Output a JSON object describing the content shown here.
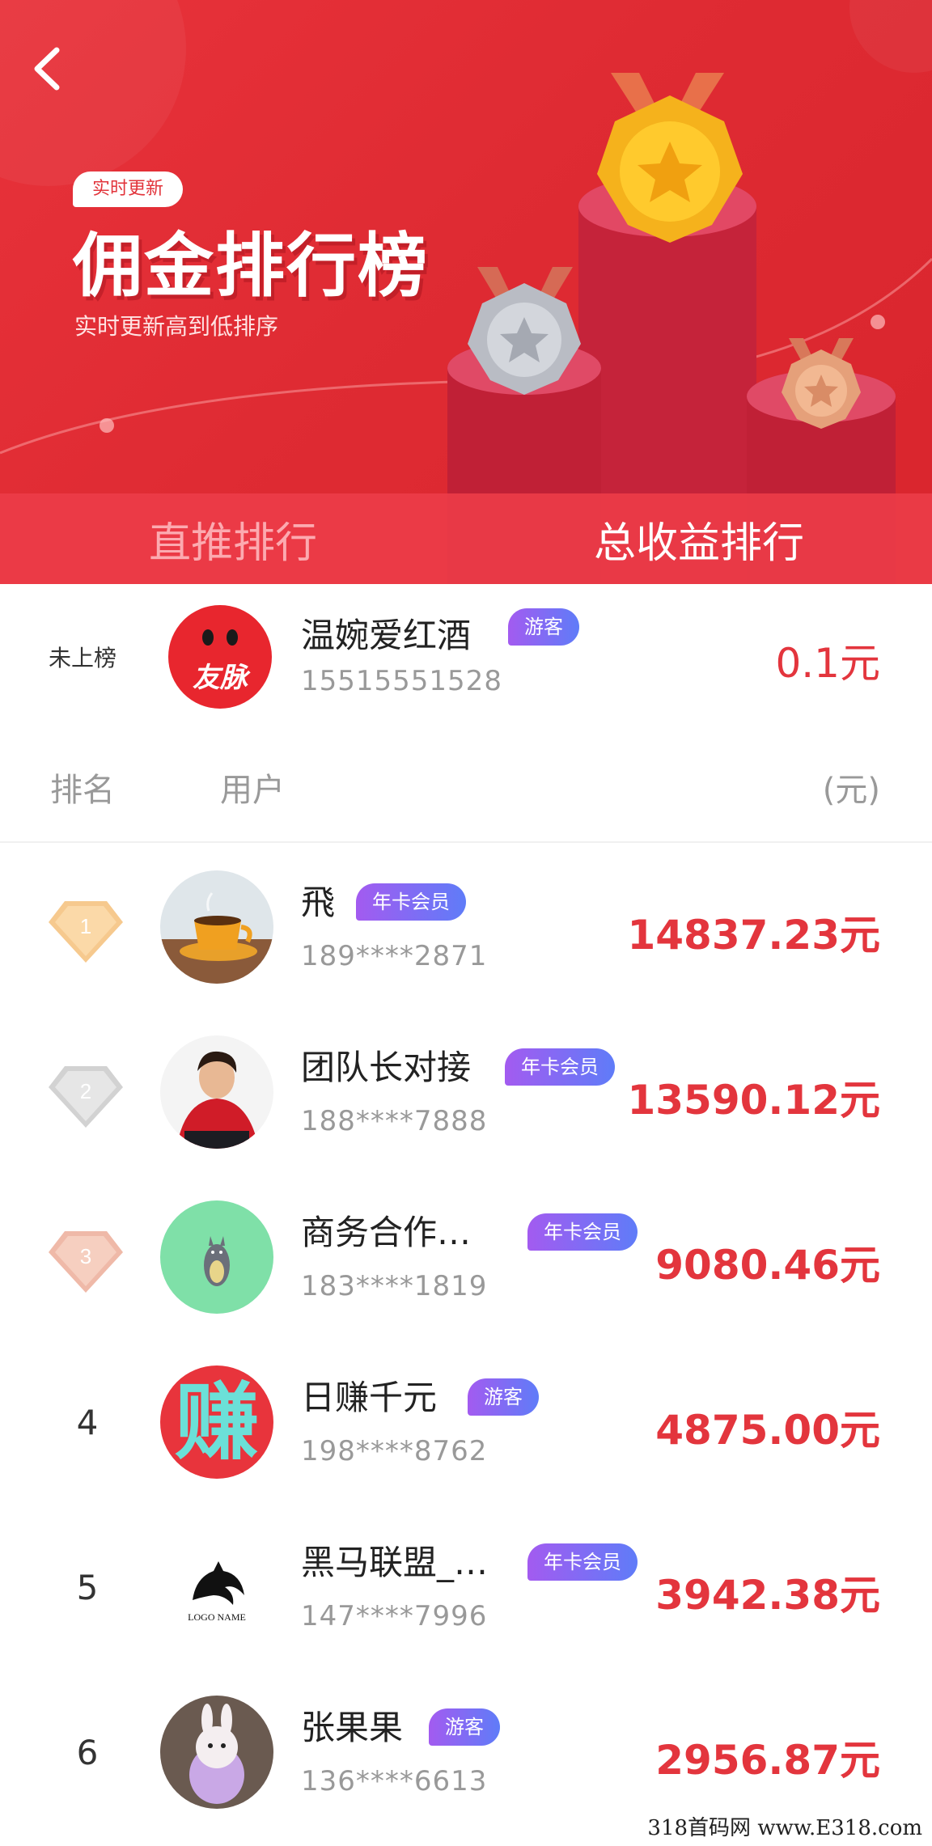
{
  "header": {
    "back_icon": "chevron-left-icon",
    "badge": "实时更新",
    "title": "佣金排行榜",
    "subtitle": "实时更新高到低排序"
  },
  "tabs": [
    {
      "label": "直推排行",
      "active": false
    },
    {
      "label": "总收益排行",
      "active": true
    }
  ],
  "me": {
    "status": "未上榜",
    "avatar_text": "友脉",
    "name": "温婉爱红酒",
    "badge": "游客",
    "phone": "15515551528",
    "amount": "0.1元"
  },
  "columns": {
    "rank": "排名",
    "user": "用户",
    "amount": "(元)"
  },
  "ranking": [
    {
      "rank": "1",
      "name": "飛",
      "badge": "年卡会员",
      "phone": "189****2871",
      "amount": "14837.23元"
    },
    {
      "rank": "2",
      "name": "团队长对接",
      "badge": "年卡会员",
      "phone": "188****7888",
      "amount": "13590.12元"
    },
    {
      "rank": "3",
      "name": "商务合作…",
      "badge": "年卡会员",
      "phone": "183****1819",
      "amount": "9080.46元"
    },
    {
      "rank": "4",
      "name": "日赚千元",
      "badge": "游客",
      "phone": "198****8762",
      "amount": "4875.00元",
      "avatar_text": "赚"
    },
    {
      "rank": "5",
      "name": "黑马联盟_…",
      "badge": "年卡会员",
      "phone": "147****7996",
      "amount": "3942.38元",
      "avatar_text": "LOGO NAME"
    },
    {
      "rank": "6",
      "name": "张果果",
      "badge": "游客",
      "phone": "136****6613",
      "amount": "2956.87元"
    }
  ],
  "colors": {
    "accent": "#e3353d",
    "hero": "#e0303a",
    "badge_start": "#a35bf0",
    "badge_end": "#5f7cf8"
  },
  "watermark": "318首码网 www.E318.com"
}
